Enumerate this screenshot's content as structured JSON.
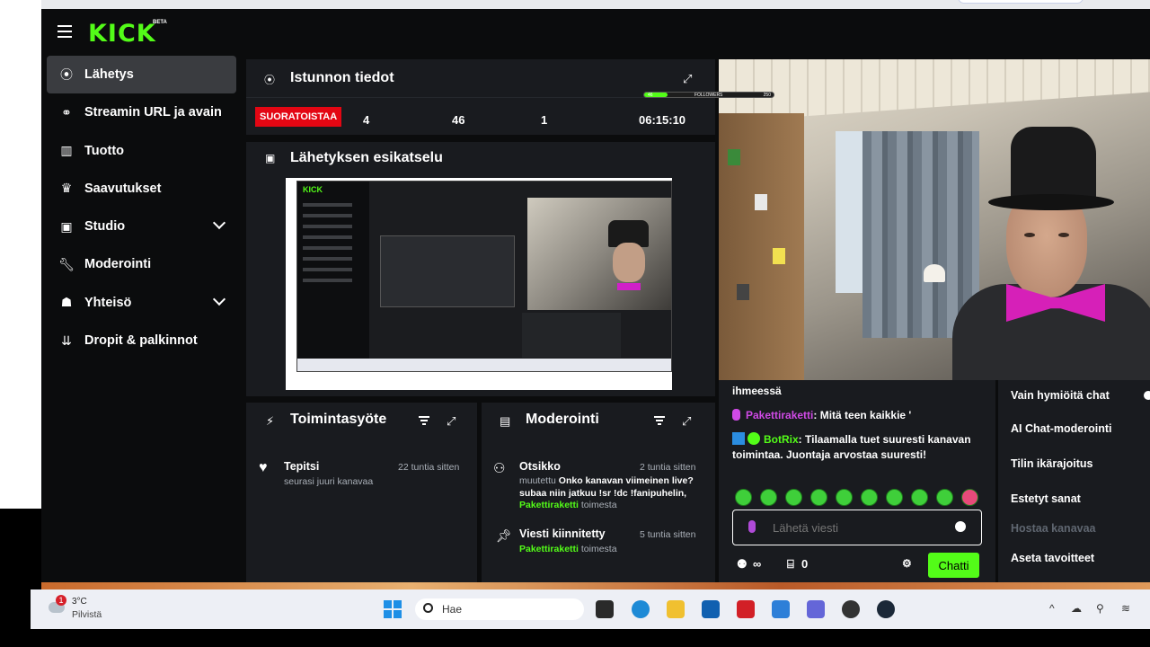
{
  "app": {
    "logo": "KICK",
    "logo_badge": "BETA"
  },
  "sidebar": {
    "items": [
      {
        "label": "Lähetys",
        "icon": "broadcast-icon",
        "active": true
      },
      {
        "label": "Streamin URL ja avain",
        "icon": "link-icon"
      },
      {
        "label": "Tuotto",
        "icon": "chart-icon"
      },
      {
        "label": "Saavutukset",
        "icon": "trophy-icon"
      },
      {
        "label": "Studio",
        "icon": "studio-icon",
        "expandable": true
      },
      {
        "label": "Moderointi",
        "icon": "wrench-icon"
      },
      {
        "label": "Yhteisö",
        "icon": "community-icon",
        "expandable": true
      },
      {
        "label": "Dropit & palkinnot",
        "icon": "drops-icon"
      }
    ]
  },
  "session": {
    "title": "Istunnon tiedot",
    "live_badge": "SUORATOISTAA",
    "stats": [
      "4",
      "46",
      "1",
      "06:15:10"
    ]
  },
  "preview": {
    "title": "Lähetyksen esikatselu"
  },
  "overlay": {
    "followers_label": "FOLLOWERS",
    "followers_count": "250",
    "followers_current": "46",
    "followers_progress": 0.18
  },
  "activity": {
    "title": "Toimintasyöte",
    "items": [
      {
        "name": "Tepitsi",
        "time": "22 tuntia sitten",
        "desc": "seurasi juuri kanavaa"
      }
    ]
  },
  "moderation": {
    "title": "Moderointi",
    "items": [
      {
        "name": "Otsikko",
        "time": "2 tuntia sitten",
        "prefix": "muutettu",
        "text": "Onko kanavan viimeinen live? subaa niin jatkuu !sr !dc !fanipuhelin,",
        "user": "Pakettiraketti",
        "suffix": "toimesta"
      },
      {
        "name": "Viesti kiinnitetty",
        "time": "5 tuntia sitten",
        "user": "Pakettiraketti",
        "suffix": "toimesta"
      }
    ]
  },
  "chat": {
    "partial_line": "ihmeessä",
    "messages": [
      {
        "user": "Pakettiraketti",
        "text": ": Mitä teen kaikkie '",
        "user_color": "#d04ae6"
      },
      {
        "user": "BotRix",
        "text": ": Tilaamalla tuet suuresti kanavan toimintaa. Juontaja arvostaa suuresti!",
        "user_color": "#53fc18"
      }
    ],
    "input_placeholder": "Lähetä viesti",
    "viewers_symbol": "∞",
    "gift_count": "0",
    "send_label": "Chatti"
  },
  "settings": {
    "items": [
      "Vain hymiöitä chat",
      "AI Chat-moderointi",
      "Tilin ikärajoitus",
      "Estetyt sanat",
      "Hostaa kanavaa",
      "Aseta tavoitteet"
    ]
  },
  "taskbar": {
    "weather_temp": "3°C",
    "weather_desc": "Pilvistä",
    "weather_badge": "1",
    "search_placeholder": "Hae"
  }
}
